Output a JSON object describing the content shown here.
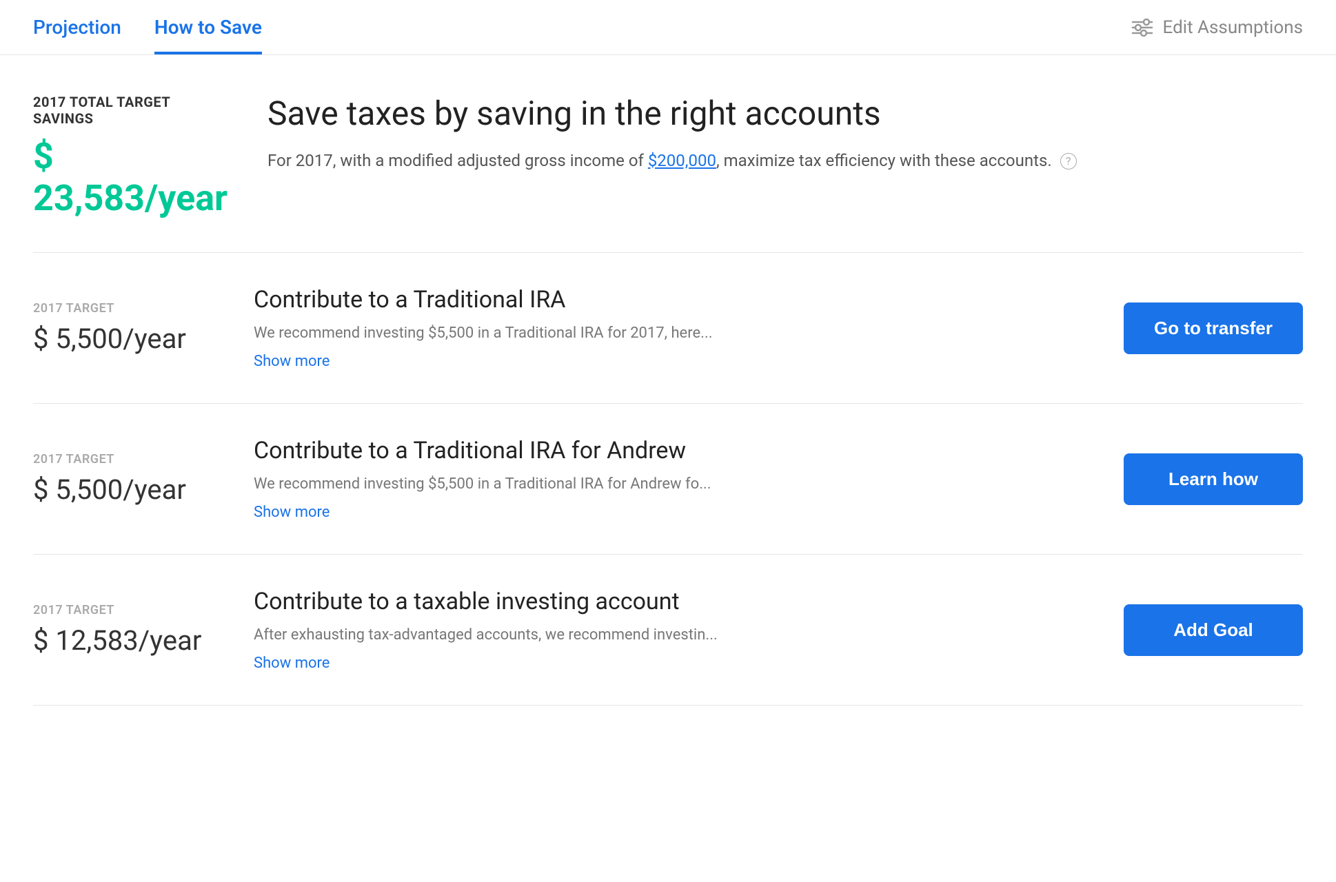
{
  "tabs": {
    "projection": {
      "label": "Projection",
      "active": false
    },
    "how_to_save": {
      "label": "How to Save",
      "active": true
    }
  },
  "header": {
    "edit_assumptions_label": "Edit Assumptions"
  },
  "hero": {
    "label": "2017 TOTAL TARGET SAVINGS",
    "amount": "$ 23,583/year",
    "title": "Save taxes by saving in the right accounts",
    "description_pre": "For 2017, with a modified adjusted gross income of ",
    "income_link": "$200,000",
    "description_post": ", maximize tax efficiency with these accounts.",
    "info_icon": "?"
  },
  "recommendations": [
    {
      "id": "rec-1",
      "target_label": "2017 TARGET",
      "amount": "$ 5,500/year",
      "title": "Contribute to a Traditional IRA",
      "description": "We recommend investing $5,500 in a Traditional IRA for 2017, here...",
      "show_more": "Show more",
      "action_label": "Go to transfer"
    },
    {
      "id": "rec-2",
      "target_label": "2017 TARGET",
      "amount": "$ 5,500/year",
      "title": "Contribute to a Traditional IRA for Andrew",
      "description": "We recommend investing $5,500 in a Traditional IRA for Andrew fo...",
      "show_more": "Show more",
      "action_label": "Learn how"
    },
    {
      "id": "rec-3",
      "target_label": "2017 TARGET",
      "amount": "$ 12,583/year",
      "title": "Contribute to a taxable investing account",
      "description": "After exhausting tax-advantaged accounts, we recommend investin...",
      "show_more": "Show more",
      "action_label": "Add Goal"
    }
  ]
}
